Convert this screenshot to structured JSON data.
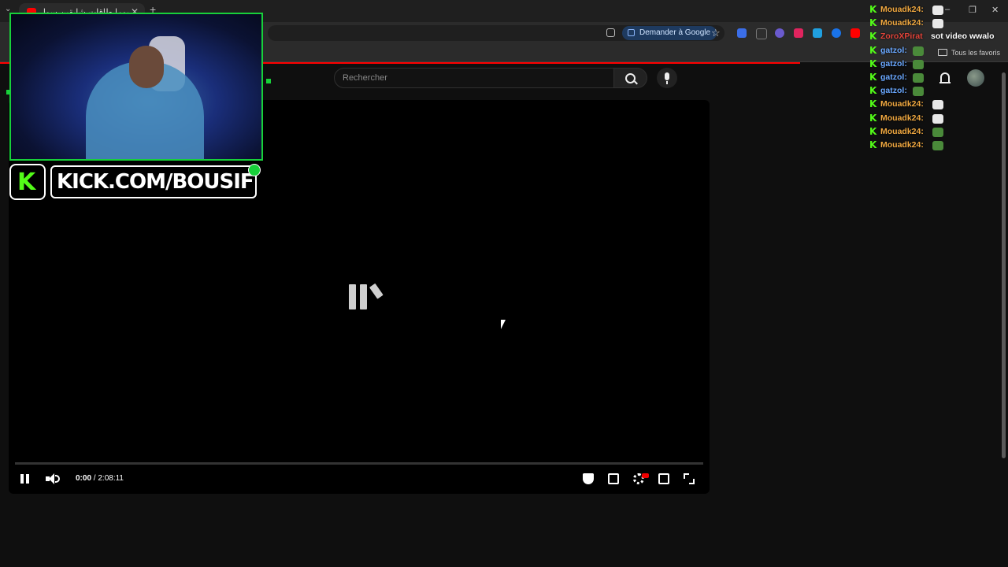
{
  "browser": {
    "tab_title": "يوما طاقات شابقين سوال اكم",
    "ask_google_label": "Demander à Google",
    "bookmarks_all_label": "Tous les favoris",
    "accent_color": "#ff0000"
  },
  "youtube": {
    "search_placeholder": "Rechercher"
  },
  "player": {
    "current_time": "0:00",
    "separator": " / ",
    "duration": "2:08:11",
    "state": "buffering"
  },
  "overlay": {
    "kick_url": "KICK.COM/BOUSIF",
    "brand_color": "#53fc18"
  },
  "chat": {
    "messages": [
      {
        "user": "Mouadk24:",
        "color": "#f0a840",
        "emote": "ghost"
      },
      {
        "user": "Mouadk24:",
        "color": "#f0a840",
        "emote": "ghost"
      },
      {
        "user": "ZoroXPirat",
        "color": "#e0443a",
        "msg": "sot video wwalo"
      },
      {
        "user": "gatzol:",
        "color": "#6aa8ff",
        "emote": "pepe"
      },
      {
        "user": "gatzol:",
        "color": "#6aa8ff",
        "emote": "pepe"
      },
      {
        "user": "gatzol:",
        "color": "#6aa8ff",
        "emote": "pepe"
      },
      {
        "user": "gatzol:",
        "color": "#6aa8ff",
        "emote": "pepe"
      },
      {
        "user": "Mouadk24:",
        "color": "#f0a840",
        "emote": "ghost"
      },
      {
        "user": "Mouadk24:",
        "color": "#f0a840",
        "emote": "ghost"
      },
      {
        "user": "Mouadk24:",
        "color": "#f0a840",
        "emote": "pepe"
      },
      {
        "user": "Mouadk24:",
        "color": "#f0a840",
        "emote": "pepe"
      }
    ]
  }
}
